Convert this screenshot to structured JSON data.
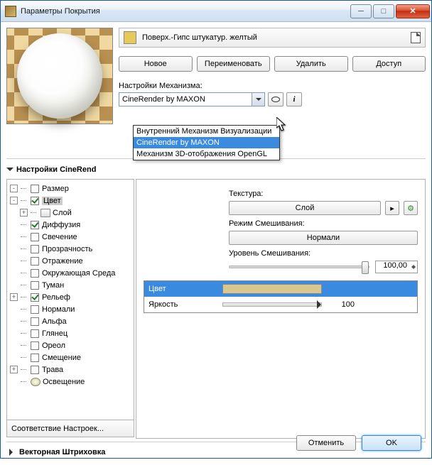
{
  "window": {
    "title": "Параметры Покрытия"
  },
  "material": {
    "name": "Поверх.-Гипс штукатур. желтый"
  },
  "buttons": {
    "new": "Новое",
    "rename": "Переименовать",
    "delete": "Удалить",
    "access": "Доступ"
  },
  "engine": {
    "label": "Настройки Механизма:",
    "value": "CineRender by MAXON",
    "options": [
      "Внутренний Механизм Визуализации",
      "CineRender by MAXON",
      "Механизм 3D-отображения OpenGL"
    ]
  },
  "sections": {
    "cinerender": "Настройки CineRend",
    "hatching": "Векторная Штриховка"
  },
  "tree": {
    "items": [
      {
        "label": "Размер",
        "checked": false,
        "exp": "-",
        "depth": 0
      },
      {
        "label": "Цвет",
        "checked": true,
        "exp": "-",
        "depth": 0,
        "selected": true
      },
      {
        "label": "Слой",
        "checked": null,
        "exp": "+",
        "depth": 1,
        "layericon": true
      },
      {
        "label": "Диффузия",
        "checked": true,
        "exp": null,
        "depth": 0
      },
      {
        "label": "Свечение",
        "checked": false,
        "exp": null,
        "depth": 0
      },
      {
        "label": "Прозрачность",
        "checked": false,
        "exp": null,
        "depth": 0
      },
      {
        "label": "Отражение",
        "checked": false,
        "exp": null,
        "depth": 0
      },
      {
        "label": "Окружающая Среда",
        "checked": false,
        "exp": null,
        "depth": 0
      },
      {
        "label": "Туман",
        "checked": false,
        "exp": null,
        "depth": 0
      },
      {
        "label": "Рельеф",
        "checked": true,
        "exp": "+",
        "depth": 0
      },
      {
        "label": "Нормали",
        "checked": false,
        "exp": null,
        "depth": 0
      },
      {
        "label": "Альфа",
        "checked": false,
        "exp": null,
        "depth": 0
      },
      {
        "label": "Глянец",
        "checked": false,
        "exp": null,
        "depth": 0
      },
      {
        "label": "Ореол",
        "checked": false,
        "exp": null,
        "depth": 0
      },
      {
        "label": "Смещение",
        "checked": false,
        "exp": null,
        "depth": 0
      },
      {
        "label": "Трава",
        "checked": false,
        "exp": "+",
        "depth": 0
      },
      {
        "label": "Освещение",
        "checked": null,
        "exp": null,
        "depth": 0,
        "lampicon": true
      }
    ],
    "footer": "Соответствие Настроек..."
  },
  "props": {
    "texture_label": "Текстура:",
    "texture_btn": "Слой",
    "blend_label": "Режим Смешивания:",
    "blend_btn": "Нормали",
    "mix_label": "Уровень Смешивания:",
    "mix_value": "100,00",
    "grid": {
      "color_label": "Цвет",
      "bright_label": "Яркость",
      "bright_value": "100"
    }
  },
  "footer": {
    "cancel": "Отменить",
    "ok": "OK"
  }
}
